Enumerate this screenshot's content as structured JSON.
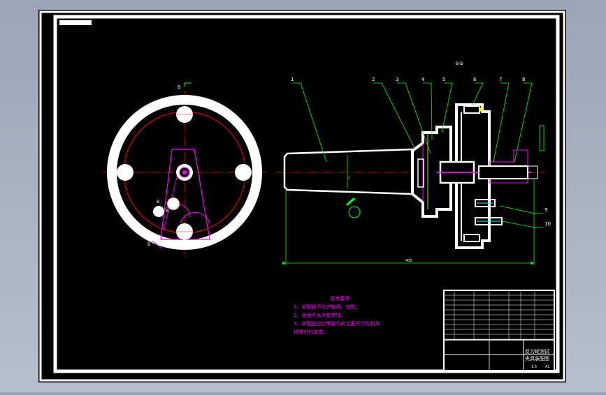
{
  "colors": {
    "background": "#000000",
    "frame": "#ffffff",
    "dimension": "#00ff00",
    "center_line": "#ff0000",
    "outline": "#ff00ff",
    "leader": "#ffff00",
    "bolt": "#00ffff"
  },
  "section_title": "B-B",
  "section_marks": {
    "top": "B",
    "bottom": "B"
  },
  "small_labels": {
    "left": "B",
    "right": "B"
  },
  "part_numbers": [
    "1",
    "2",
    "3",
    "4",
    "5",
    "6",
    "7",
    "8",
    "9",
    "10"
  ],
  "dimensions": {
    "overall_length": "400",
    "shaft_dia": "2"
  },
  "tech_requirements": {
    "title": "技术要求",
    "items": [
      "1、装配前不允许磕碰、划伤；",
      "2、表面不允许有锈蚀；",
      "3、装配前应对零部件的主要尺寸及相关",
      "精度进行复查。"
    ]
  },
  "title_block": {
    "title_line1": "反力矩测试",
    "title_line2": "夹具装配图",
    "scale": "1:5",
    "sheet": "A2"
  }
}
